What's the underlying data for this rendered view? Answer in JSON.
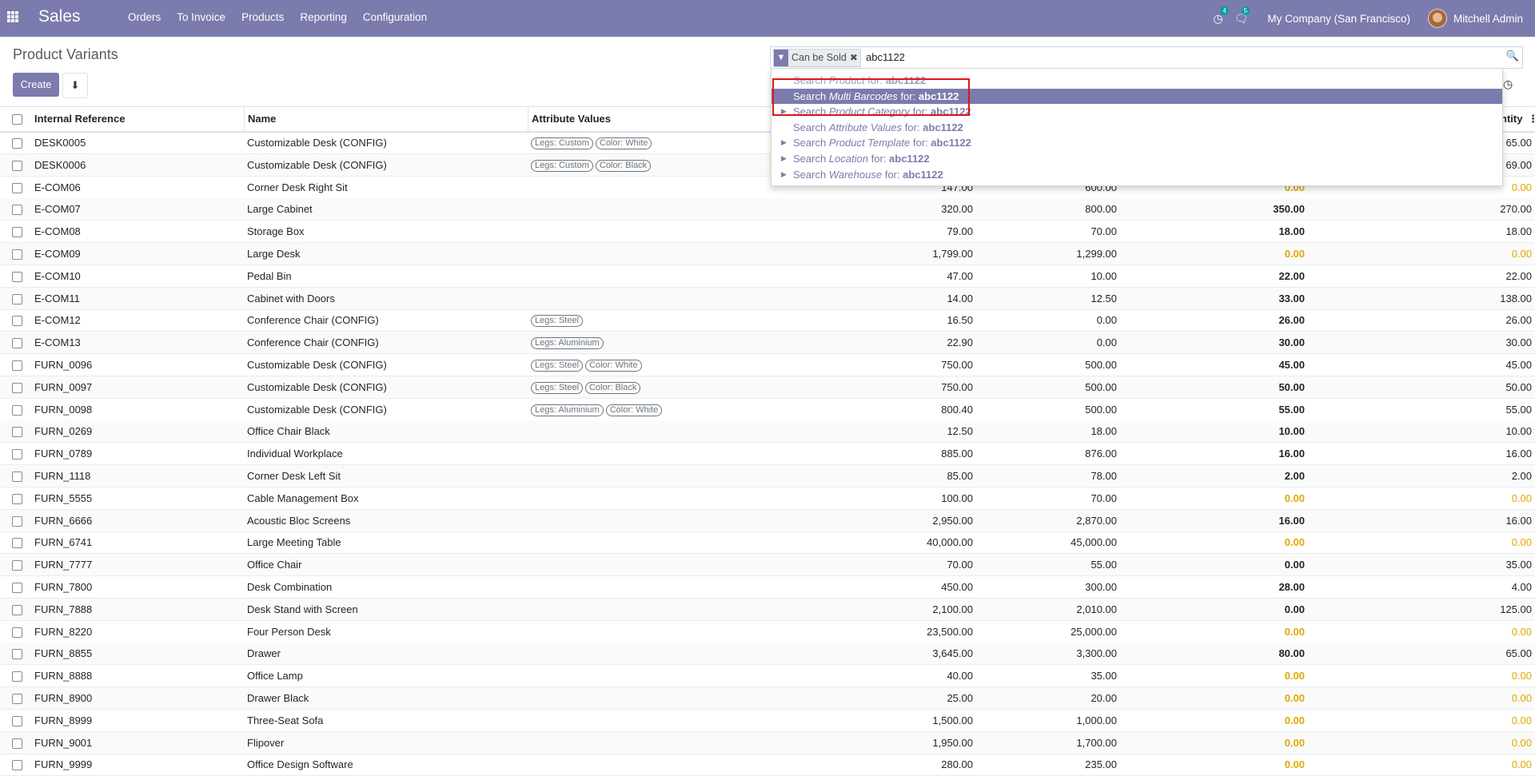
{
  "navbar": {
    "brand": "Sales",
    "menu": [
      "Orders",
      "To Invoice",
      "Products",
      "Reporting",
      "Configuration"
    ],
    "activity_count": "4",
    "message_count": "5",
    "company": "My Company (San Francisco)",
    "user": "Mitchell Admin"
  },
  "page": {
    "title": "Product Variants",
    "create_label": "Create"
  },
  "search": {
    "facet_label": "Can be Sold",
    "value": "abc1122"
  },
  "dropdown": {
    "items": [
      {
        "prefix": "Search",
        "field": "Product",
        "suffix": "for:",
        "term": "abc1122",
        "expandable": false
      },
      {
        "prefix": "Search",
        "field": "Multi Barcodes",
        "suffix": "for:",
        "term": "abc1122",
        "expandable": false
      },
      {
        "prefix": "Search",
        "field": "Product Category",
        "suffix": "for:",
        "term": "abc1122",
        "expandable": true
      },
      {
        "prefix": "Search",
        "field": "Attribute Values",
        "suffix": "for:",
        "term": "abc1122",
        "expandable": false
      },
      {
        "prefix": "Search",
        "field": "Product Template",
        "suffix": "for:",
        "term": "abc1122",
        "expandable": true
      },
      {
        "prefix": "Search",
        "field": "Location",
        "suffix": "for:",
        "term": "abc1122",
        "expandable": true
      },
      {
        "prefix": "Search",
        "field": "Warehouse",
        "suffix": "for:",
        "term": "abc1122",
        "expandable": true
      }
    ]
  },
  "table": {
    "headers": {
      "ref": "Internal Reference",
      "name": "Name",
      "attrs": "Attribute Values",
      "qty": "ntity"
    },
    "rows": [
      {
        "ref": "DESK0005",
        "name": "Customizable Desk (CONFIG)",
        "attrs": [
          "Legs: Custom",
          "Color: White"
        ],
        "price": "",
        "cost": "",
        "onhand": "",
        "forecast": "65.00",
        "zero": false
      },
      {
        "ref": "DESK0006",
        "name": "Customizable Desk (CONFIG)",
        "attrs": [
          "Legs: Custom",
          "Color: Black"
        ],
        "price": "",
        "cost": "",
        "onhand": "",
        "forecast": "69.00",
        "zero": false
      },
      {
        "ref": "E-COM06",
        "name": "Corner Desk Right Sit",
        "attrs": [],
        "price": "147.00",
        "cost": "600.00",
        "onhand": "0.00",
        "forecast": "0.00",
        "zero": true
      },
      {
        "ref": "E-COM07",
        "name": "Large Cabinet",
        "attrs": [],
        "price": "320.00",
        "cost": "800.00",
        "onhand": "350.00",
        "forecast": "270.00",
        "zero": false
      },
      {
        "ref": "E-COM08",
        "name": "Storage Box",
        "attrs": [],
        "price": "79.00",
        "cost": "70.00",
        "onhand": "18.00",
        "forecast": "18.00",
        "zero": false
      },
      {
        "ref": "E-COM09",
        "name": "Large Desk",
        "attrs": [],
        "price": "1,799.00",
        "cost": "1,299.00",
        "onhand": "0.00",
        "forecast": "0.00",
        "zero": true
      },
      {
        "ref": "E-COM10",
        "name": "Pedal Bin",
        "attrs": [],
        "price": "47.00",
        "cost": "10.00",
        "onhand": "22.00",
        "forecast": "22.00",
        "zero": false
      },
      {
        "ref": "E-COM11",
        "name": "Cabinet with Doors",
        "attrs": [],
        "price": "14.00",
        "cost": "12.50",
        "onhand": "33.00",
        "forecast": "138.00",
        "zero": false
      },
      {
        "ref": "E-COM12",
        "name": "Conference Chair (CONFIG)",
        "attrs": [
          "Legs: Steel"
        ],
        "price": "16.50",
        "cost": "0.00",
        "onhand": "26.00",
        "forecast": "26.00",
        "zero": false
      },
      {
        "ref": "E-COM13",
        "name": "Conference Chair (CONFIG)",
        "attrs": [
          "Legs: Aluminium"
        ],
        "price": "22.90",
        "cost": "0.00",
        "onhand": "30.00",
        "forecast": "30.00",
        "zero": false
      },
      {
        "ref": "FURN_0096",
        "name": "Customizable Desk (CONFIG)",
        "attrs": [
          "Legs: Steel",
          "Color: White"
        ],
        "price": "750.00",
        "cost": "500.00",
        "onhand": "45.00",
        "forecast": "45.00",
        "zero": false
      },
      {
        "ref": "FURN_0097",
        "name": "Customizable Desk (CONFIG)",
        "attrs": [
          "Legs: Steel",
          "Color: Black"
        ],
        "price": "750.00",
        "cost": "500.00",
        "onhand": "50.00",
        "forecast": "50.00",
        "zero": false
      },
      {
        "ref": "FURN_0098",
        "name": "Customizable Desk (CONFIG)",
        "attrs": [
          "Legs: Aluminium",
          "Color: White"
        ],
        "price": "800.40",
        "cost": "500.00",
        "onhand": "55.00",
        "forecast": "55.00",
        "zero": false
      },
      {
        "ref": "FURN_0269",
        "name": "Office Chair Black",
        "attrs": [],
        "price": "12.50",
        "cost": "18.00",
        "onhand": "10.00",
        "forecast": "10.00",
        "zero": false
      },
      {
        "ref": "FURN_0789",
        "name": "Individual Workplace",
        "attrs": [],
        "price": "885.00",
        "cost": "876.00",
        "onhand": "16.00",
        "forecast": "16.00",
        "zero": false
      },
      {
        "ref": "FURN_1118",
        "name": "Corner Desk Left Sit",
        "attrs": [],
        "price": "85.00",
        "cost": "78.00",
        "onhand": "2.00",
        "forecast": "2.00",
        "zero": false
      },
      {
        "ref": "FURN_5555",
        "name": "Cable Management Box",
        "attrs": [],
        "price": "100.00",
        "cost": "70.00",
        "onhand": "0.00",
        "forecast": "0.00",
        "zero": true
      },
      {
        "ref": "FURN_6666",
        "name": "Acoustic Bloc Screens",
        "attrs": [],
        "price": "2,950.00",
        "cost": "2,870.00",
        "onhand": "16.00",
        "forecast": "16.00",
        "zero": false
      },
      {
        "ref": "FURN_6741",
        "name": "Large Meeting Table",
        "attrs": [],
        "price": "40,000.00",
        "cost": "45,000.00",
        "onhand": "0.00",
        "forecast": "0.00",
        "zero": true
      },
      {
        "ref": "FURN_7777",
        "name": "Office Chair",
        "attrs": [],
        "price": "70.00",
        "cost": "55.00",
        "onhand": "0.00",
        "forecast": "35.00",
        "zero": false
      },
      {
        "ref": "FURN_7800",
        "name": "Desk Combination",
        "attrs": [],
        "price": "450.00",
        "cost": "300.00",
        "onhand": "28.00",
        "forecast": "4.00",
        "zero": false
      },
      {
        "ref": "FURN_7888",
        "name": "Desk Stand with Screen",
        "attrs": [],
        "price": "2,100.00",
        "cost": "2,010.00",
        "onhand": "0.00",
        "forecast": "125.00",
        "zero": false
      },
      {
        "ref": "FURN_8220",
        "name": "Four Person Desk",
        "attrs": [],
        "price": "23,500.00",
        "cost": "25,000.00",
        "onhand": "0.00",
        "forecast": "0.00",
        "zero": true
      },
      {
        "ref": "FURN_8855",
        "name": "Drawer",
        "attrs": [],
        "price": "3,645.00",
        "cost": "3,300.00",
        "onhand": "80.00",
        "forecast": "65.00",
        "zero": false
      },
      {
        "ref": "FURN_8888",
        "name": "Office Lamp",
        "attrs": [],
        "price": "40.00",
        "cost": "35.00",
        "onhand": "0.00",
        "forecast": "0.00",
        "zero": true
      },
      {
        "ref": "FURN_8900",
        "name": "Drawer Black",
        "attrs": [],
        "price": "25.00",
        "cost": "20.00",
        "onhand": "0.00",
        "forecast": "0.00",
        "zero": true
      },
      {
        "ref": "FURN_8999",
        "name": "Three-Seat Sofa",
        "attrs": [],
        "price": "1,500.00",
        "cost": "1,000.00",
        "onhand": "0.00",
        "forecast": "0.00",
        "zero": true
      },
      {
        "ref": "FURN_9001",
        "name": "Flipover",
        "attrs": [],
        "price": "1,950.00",
        "cost": "1,700.00",
        "onhand": "0.00",
        "forecast": "0.00",
        "zero": true
      },
      {
        "ref": "FURN_9999",
        "name": "Office Design Software",
        "attrs": [],
        "price": "280.00",
        "cost": "235.00",
        "onhand": "0.00",
        "forecast": "0.00",
        "zero": true
      }
    ]
  },
  "colors": {
    "brand": "#7c7bad",
    "warning": "#e0a800",
    "highlight": "#e0131a"
  }
}
